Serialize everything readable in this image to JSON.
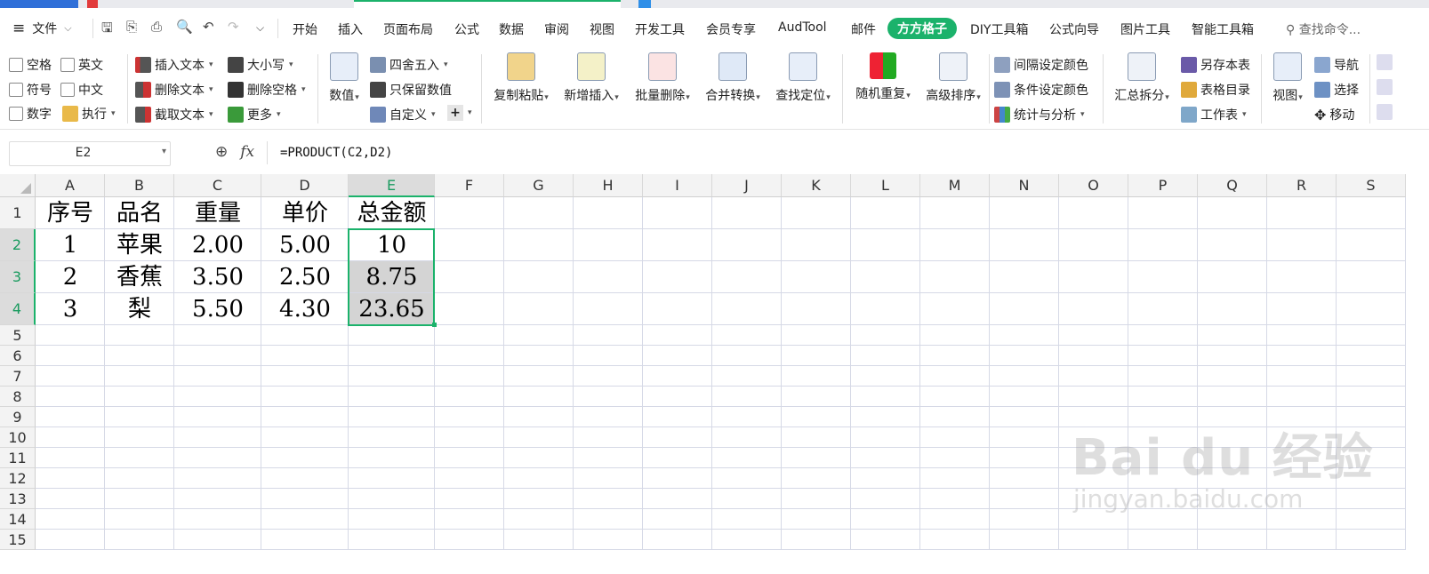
{
  "menu": {
    "file_label": "文件",
    "tabs": [
      "开始",
      "插入",
      "页面布局",
      "公式",
      "数据",
      "审阅",
      "视图",
      "开发工具",
      "会员专享",
      "AudTool",
      "邮件",
      "方方格子",
      "DIY工具箱",
      "公式向导",
      "图片工具",
      "智能工具箱"
    ],
    "active_tab": "方方格子",
    "search_label": "查找命令..."
  },
  "ribbon": {
    "checkboxes": [
      "空格",
      "英文",
      "符号",
      "中文",
      "数字"
    ],
    "exec_label": "执行",
    "text_buttons": [
      "插入文本",
      "删除文本",
      "截取文本"
    ],
    "case_buttons": [
      "大小写",
      "删除空格",
      "更多"
    ],
    "number_label": "数值",
    "number_buttons": [
      "四舍五入",
      "只保留数值",
      "自定义"
    ],
    "big_buttons": [
      "复制粘贴",
      "新增插入",
      "批量删除",
      "合并转换",
      "查找定位",
      "随机重复",
      "高级排序"
    ],
    "color_buttons": [
      "间隔设定颜色",
      "条件设定颜色",
      "统计与分析"
    ],
    "summary_label": "汇总拆分",
    "sheet_buttons": [
      "另存本表",
      "表格目录",
      "工作表"
    ],
    "view_label": "视图",
    "nav_buttons": [
      "导航",
      "选择",
      "移动"
    ]
  },
  "formula_bar": {
    "cell_ref": "E2",
    "fx_label": "fx",
    "formula": "=PRODUCT(C2,D2)"
  },
  "sheet": {
    "columns": [
      "A",
      "B",
      "C",
      "D",
      "E",
      "F",
      "G",
      "H",
      "I",
      "J",
      "K",
      "L",
      "M",
      "N",
      "O",
      "P",
      "Q",
      "R",
      "S"
    ],
    "rows": [
      "1",
      "2",
      "3",
      "4",
      "5",
      "6",
      "7",
      "8",
      "9",
      "10",
      "11",
      "12",
      "13",
      "14",
      "15"
    ],
    "selected_column": "E",
    "selected_rows": [
      "2",
      "3",
      "4"
    ],
    "data": [
      [
        "序号",
        "品名",
        "重量",
        "单价",
        "总金额"
      ],
      [
        "1",
        "苹果",
        "2.00",
        "5.00",
        "10"
      ],
      [
        "2",
        "香蕉",
        "3.50",
        "2.50",
        "8.75"
      ],
      [
        "3",
        "梨",
        "5.50",
        "4.30",
        "23.65"
      ]
    ]
  },
  "watermark": {
    "brand": "Bai du 经验",
    "url": "jingyan.baidu.com"
  },
  "colors": {
    "accent": "#1bb26b",
    "selection_fill": "#d4d4d4",
    "grid_line": "#d6d9e6"
  }
}
